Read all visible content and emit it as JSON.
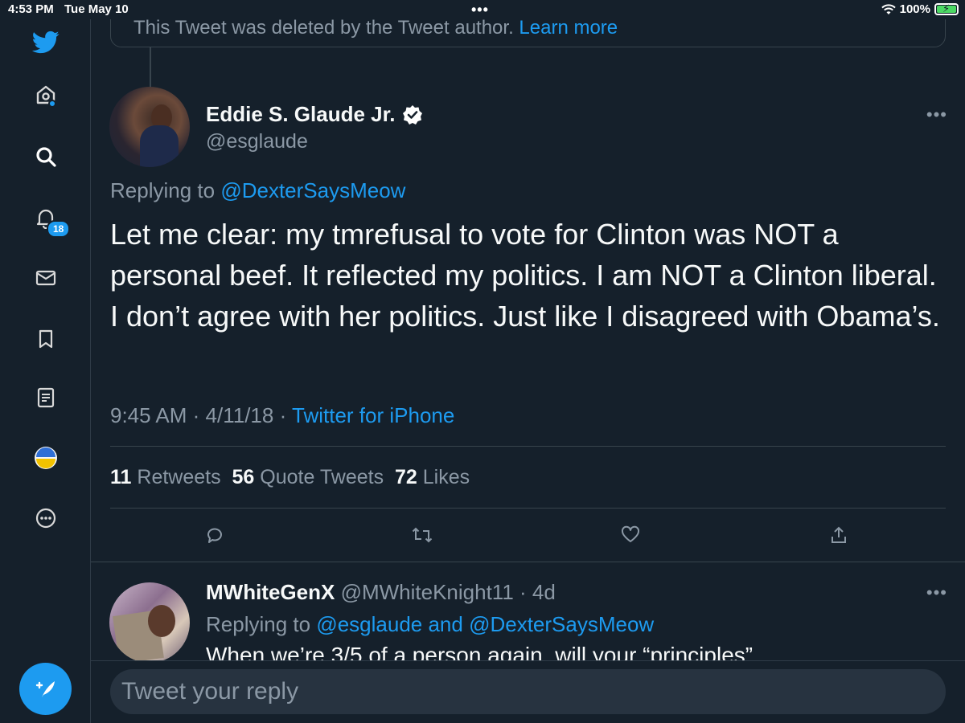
{
  "status_bar": {
    "time": "4:53 PM",
    "date": "Tue May 10",
    "dots": "•••",
    "battery": "100%"
  },
  "sidebar": {
    "notification_count": "18",
    "items": [
      "twitter-logo",
      "home",
      "search",
      "notifications",
      "messages",
      "bookmarks",
      "lists",
      "profile",
      "more"
    ]
  },
  "deleted_notice": {
    "text": "This Tweet was deleted by the Tweet author.",
    "link": "Learn more"
  },
  "tweet": {
    "author_name": "Eddie S. Glaude Jr.",
    "handle": "@esglaude",
    "replying_prefix": "Replying to",
    "replying_to": "@DexterSaysMeow",
    "text": "Let me clear: my tmrefusal to vote for Clinton was NOT a personal beef. It reflected my politics. I am NOT a Clinton liberal. I don’t agree with her politics. Just like I disagreed with Obama’s.",
    "time": "9:45 AM",
    "date": "4/11/18",
    "source": "Twitter for iPhone",
    "stats": {
      "retweets_count": "11",
      "retweets_label": "Retweets",
      "quotes_count": "56",
      "quotes_label": "Quote Tweets",
      "likes_count": "72",
      "likes_label": "Likes"
    }
  },
  "reply": {
    "name": "MWhiteGenX",
    "handle": "@MWhiteKnight11",
    "age": "4d",
    "replying_prefix": "Replying to",
    "replying_to": "@esglaude and @DexterSaysMeow",
    "text": "When we’re 3/5 of a person again, will your “principles”"
  },
  "composer": {
    "placeholder": "Tweet your reply"
  },
  "colors": {
    "background": "#15202b",
    "accent": "#1d9bf0",
    "secondary_text": "#8b98a5"
  }
}
